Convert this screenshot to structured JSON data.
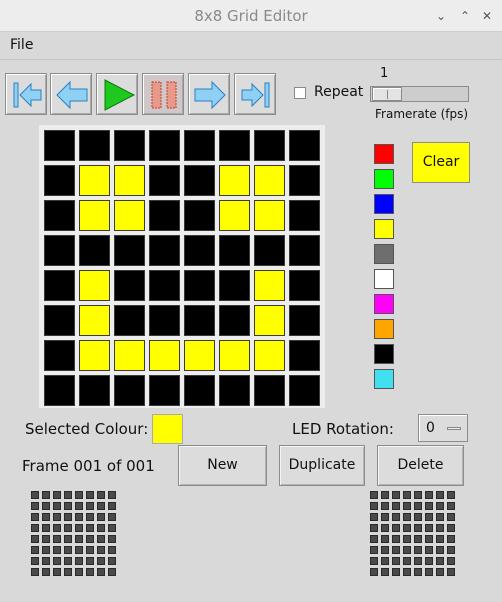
{
  "window": {
    "title": "8x8 Grid Editor"
  },
  "menu": {
    "file": "File"
  },
  "toolbar": {
    "buttons": [
      "first-frame",
      "previous-frame",
      "play",
      "pause",
      "next-frame",
      "last-frame"
    ],
    "repeat_label": "Repeat",
    "repeat_checked": false,
    "framerate_value": "1",
    "framerate_label": "Framerate (fps)"
  },
  "colors": {
    "yellow": "#ffff00",
    "black": "#000000",
    "window_bg": "#d9d9d9"
  },
  "grid": {
    "rows": [
      "KKKKKKKK",
      "KYYKKYYK",
      "KYYKKYYK",
      "KKKKKKKK",
      "KYKKKKYK",
      "KYKKKKYK",
      "KYYYYYYK",
      "KKKKKKKK"
    ],
    "legend": {
      "K": "#000000",
      "Y": "#ffff00"
    }
  },
  "palette": [
    "#ff0000",
    "#00ff00",
    "#0000ff",
    "#ffff00",
    "#6e6e6e",
    "#ffffff",
    "#ff00ff",
    "#ffa500",
    "#000000",
    "#40e0f0"
  ],
  "clear_label": "Clear",
  "selected": {
    "label": "Selected Colour:",
    "color": "#ffff00"
  },
  "rotation": {
    "label": "LED Rotation:",
    "value": "0"
  },
  "frame": {
    "label": "Frame 001 of 001"
  },
  "actions": {
    "new": "New",
    "duplicate": "Duplicate",
    "delete": "Delete"
  }
}
